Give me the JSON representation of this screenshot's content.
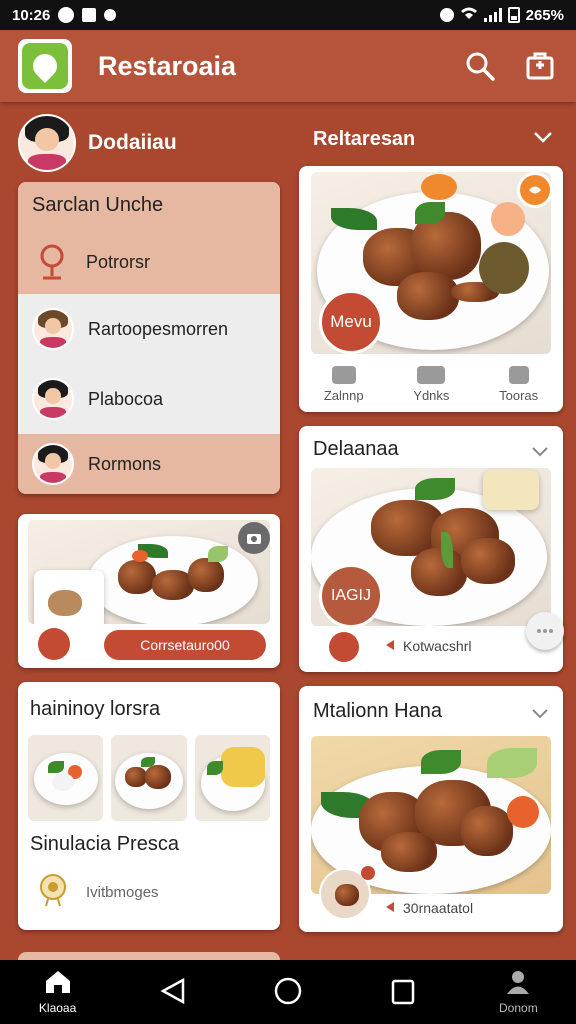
{
  "status_bar": {
    "time": "10:26",
    "battery": "265%"
  },
  "app": {
    "title": "Restaroaia"
  },
  "profile": {
    "name": "Dodaiiau"
  },
  "menu": {
    "title": "Sarclan Unche",
    "items": [
      {
        "label": "Potrorsr",
        "icon": "location-pin-icon"
      },
      {
        "label": "Rartoopesmorren",
        "icon": "avatar"
      },
      {
        "label": "Plabocoa",
        "icon": "avatar"
      },
      {
        "label": "Rormons",
        "icon": "avatar"
      }
    ]
  },
  "promo_card": {
    "button_label": "Corrsetauro00"
  },
  "hainey_card": {
    "title": "haininoy lorsra",
    "subtitle": "Sinulacia Presca",
    "footer_label": "Ivitbmoges"
  },
  "right_header": {
    "title": "Reltaresan"
  },
  "dish_cards": [
    {
      "title": "",
      "badge": "Mevu",
      "stats": [
        "Zalnnp",
        "Ydnks",
        "Tooras"
      ]
    },
    {
      "title": "Delaanaa",
      "badge": "IAGIJ",
      "action_label": "Kotwacshrl"
    },
    {
      "title": "Mtalionn Hana",
      "action_label": "30rnaatatol"
    }
  ],
  "bottom_nav": {
    "items": [
      {
        "label": "Klaoaa",
        "icon": "home-icon"
      },
      {
        "label": "",
        "icon": "back-icon"
      },
      {
        "label": "",
        "icon": "home-circle-icon"
      },
      {
        "label": "",
        "icon": "recents-icon"
      },
      {
        "label": "Donom",
        "icon": "profile-icon"
      }
    ]
  },
  "colors": {
    "brand": "#b5543a",
    "accent": "#c44b33",
    "highlight": "#e7b8a1",
    "logo": "#7cbf3a"
  }
}
